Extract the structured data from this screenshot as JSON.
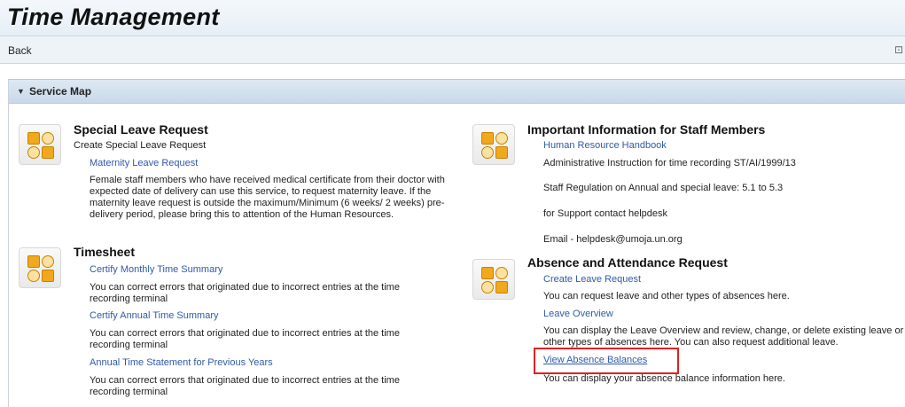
{
  "header": {
    "title": "Time Management"
  },
  "toolbar": {
    "back_label": "Back"
  },
  "service_map": {
    "title": "Service Map"
  },
  "special_leave": {
    "title": "Special Leave Request",
    "subtitle": "Create Special Leave Request",
    "link": "Maternity Leave Request",
    "desc": "Female staff members who have received medical certificate from their doctor with expected date of delivery can use this service, to request maternity leave. If the maternity leave request is outside the maximum/Minimum (6 weeks/ 2 weeks) pre-delivery period, please bring this to attention of the Human Resources."
  },
  "timesheet": {
    "title": "Timesheet",
    "items": [
      {
        "link": "Certify Monthly Time Summary",
        "desc": "You can correct errors that originated due to incorrect entries at the time recording terminal"
      },
      {
        "link": "Certify Annual Time Summary",
        "desc": "You can correct errors that originated due to incorrect entries at the time recording terminal"
      },
      {
        "link": "Annual Time Statement for Previous Years",
        "desc": "You can correct errors that originated due to incorrect entries at the time recording terminal"
      }
    ]
  },
  "important_info": {
    "title": "Important Information for Staff Members",
    "link": "Human Resource Handbook",
    "lines": [
      "Administrative Instruction for time recording ST/AI/1999/13",
      "Staff Regulation on Annual and special leave: 5.1 to 5.3",
      "for Support contact helpdesk",
      "Email - helpdesk@umoja.un.org"
    ]
  },
  "absence": {
    "title": "Absence and Attendance Request",
    "items": [
      {
        "link": "Create Leave Request",
        "desc": "You can request leave and other types of absences here."
      },
      {
        "link": "Leave Overview",
        "desc": "You can display the Leave Overview and review, change, or delete existing leave or other types of absences here. You can also request additional leave."
      },
      {
        "link": "View Absence Balances",
        "desc": "You can display your absence balance information here."
      }
    ]
  },
  "icons": {
    "service": "service-grid-icon",
    "collapse": "triangle-down-icon"
  },
  "colors": {
    "link": "#2f5aa8",
    "highlight": "#e02020",
    "icon_fill": "#f2a81c"
  }
}
